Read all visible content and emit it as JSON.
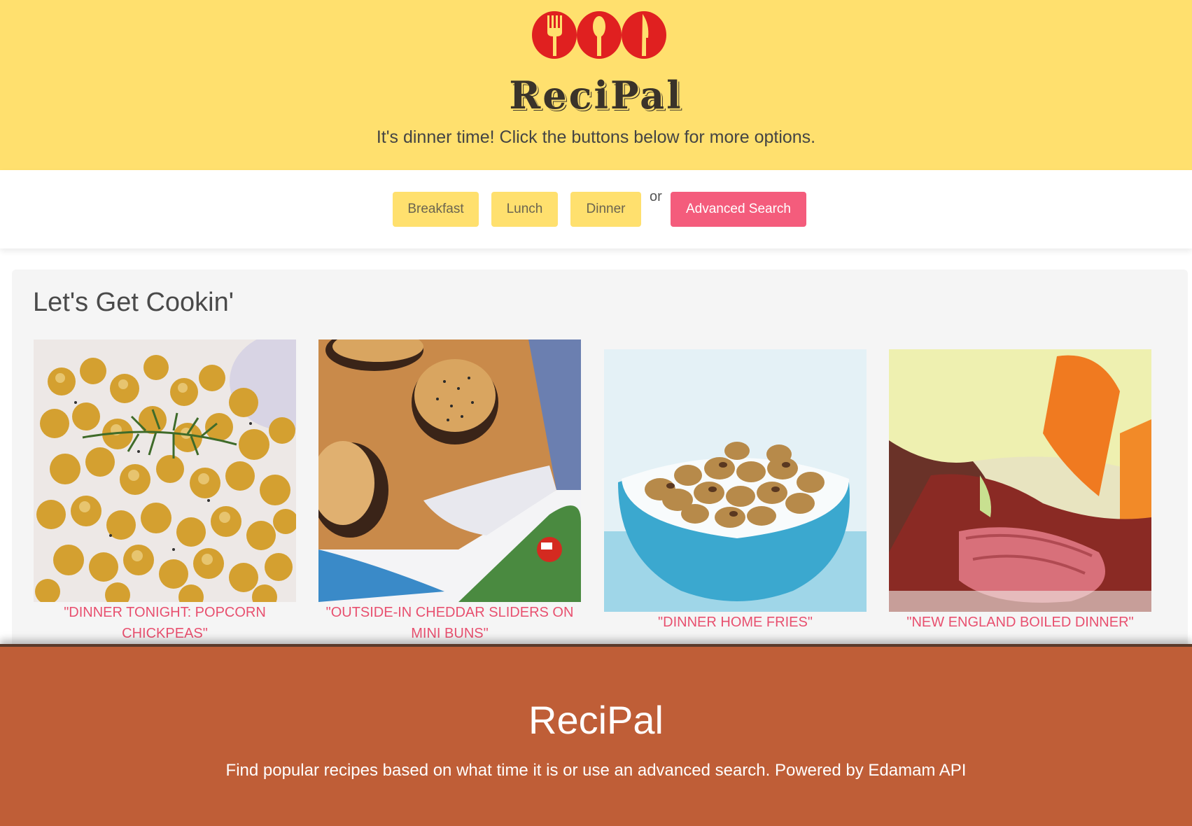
{
  "header": {
    "logo_icon": "utensils-logo-icon",
    "brand": "ReciPal",
    "tagline": "It's dinner time! Click the buttons below for more options."
  },
  "nav": {
    "breakfast_label": "Breakfast",
    "lunch_label": "Lunch",
    "dinner_label": "Dinner",
    "or_text": "or",
    "advanced_label": "Advanced Search"
  },
  "main": {
    "heading": "Let's Get Cookin'",
    "recipes": [
      {
        "title": "\"Dinner Tonight: Popcorn Chickpeas\"",
        "image": "chickpeas-photo"
      },
      {
        "title": "\"Outside-In Cheddar Sliders on Mini Buns\"",
        "image": "sliders-photo"
      },
      {
        "title": "\"Dinner Home Fries\"",
        "image": "home-fries-photo"
      },
      {
        "title": "\"New England Boiled Dinner\"",
        "image": "boiled-dinner-photo"
      }
    ]
  },
  "footer": {
    "brand": "ReciPal",
    "description": "Find popular recipes based on what time it is or use an advanced search. Powered by Edamam API"
  },
  "colors": {
    "header_bg": "#ffe06e",
    "accent_pink": "#f45c7c",
    "footer_bg": "#bf5e37",
    "logo_red": "#e02020"
  }
}
